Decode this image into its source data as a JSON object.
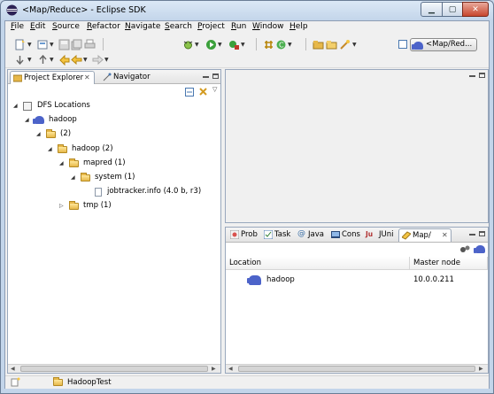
{
  "window": {
    "title": "<Map/Reduce> - Eclipse SDK"
  },
  "menu": [
    "File",
    "Edit",
    "Source",
    "Refactor",
    "Navigate",
    "Search",
    "Project",
    "Run",
    "Window",
    "Help"
  ],
  "toolbar": {
    "perspective_label": "<Map/Red..."
  },
  "left_panel": {
    "tabs": [
      {
        "label": "Project Explorer",
        "active": true
      },
      {
        "label": "Navigator",
        "active": false
      }
    ],
    "tree": [
      {
        "label": "DFS Locations",
        "depth": 0,
        "icon": "dfs-icon",
        "twisty": "expanded"
      },
      {
        "label": "hadoop",
        "depth": 1,
        "icon": "elephant-icon",
        "twisty": "expanded"
      },
      {
        "label": "(2)",
        "depth": 2,
        "icon": "folder-icon",
        "twisty": "expanded"
      },
      {
        "label": "hadoop (2)",
        "depth": 3,
        "icon": "folder-icon",
        "twisty": "expanded"
      },
      {
        "label": "mapred (1)",
        "depth": 4,
        "icon": "folder-icon",
        "twisty": "expanded"
      },
      {
        "label": "system (1)",
        "depth": 5,
        "icon": "folder-icon",
        "twisty": "expanded"
      },
      {
        "label": "jobtracker.info (4.0 b, r3)",
        "depth": 6,
        "icon": "file-icon",
        "twisty": "none"
      },
      {
        "label": "tmp (1)",
        "depth": 4,
        "icon": "folder-icon",
        "twisty": "collapsed"
      }
    ]
  },
  "bottom_panel": {
    "tabs": [
      {
        "label": "Prob",
        "active": false
      },
      {
        "label": "Task",
        "active": false
      },
      {
        "label": "Java",
        "active": false
      },
      {
        "label": "Cons",
        "active": false
      },
      {
        "label": "JUni",
        "active": false
      },
      {
        "label": "Map/",
        "active": true
      }
    ],
    "columns": [
      "Location",
      "Master node"
    ],
    "rows": [
      {
        "location": "hadoop",
        "master": "10.0.0.211"
      }
    ]
  },
  "status": {
    "project": "HadoopTest"
  },
  "colors": {
    "accent": "#4c63c9",
    "folder": "#e7b84a",
    "frame": "#c3d5ea"
  }
}
